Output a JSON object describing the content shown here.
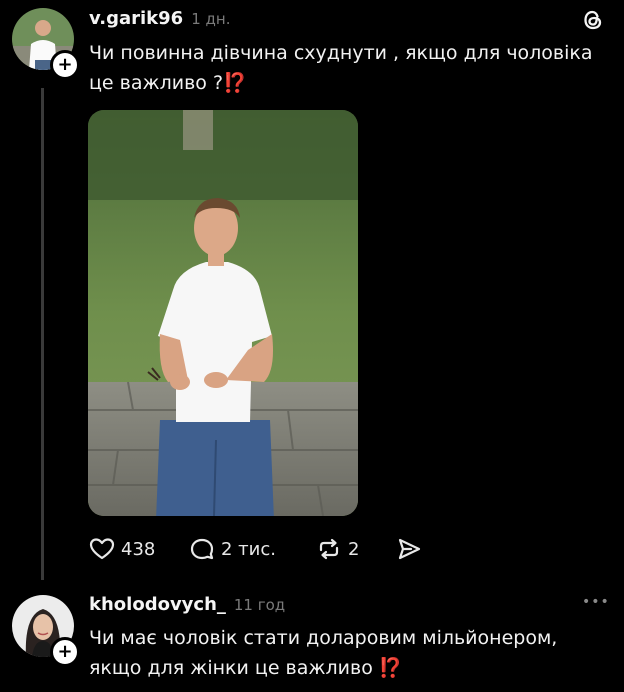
{
  "post": {
    "username": "v.garik96",
    "time": "1 дн.",
    "text": "Чи повинна дівчина схуднути , якщо для чоловіка це важливо ?",
    "emoji": "⁉️",
    "stats": {
      "likes": "438",
      "comments": "2 тис.",
      "reposts": "2"
    },
    "app_icon": "threads-logo-icon"
  },
  "reply": {
    "username": "kholodovych_",
    "time": "11 год",
    "text": "Чи має чоловік стати доларовим мільйонером, якщо для жінки це важливо",
    "emoji": "⁉️",
    "more": "•••"
  },
  "colors": {
    "background": "#000000",
    "text": "#f2f2f2",
    "muted": "#7a7a7a",
    "accent_red": "#ff3b30",
    "thread_line": "#3a3a3a"
  }
}
